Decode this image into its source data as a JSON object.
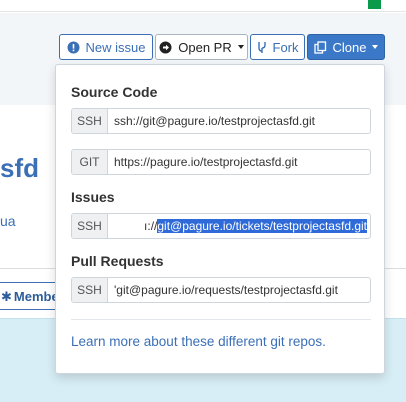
{
  "background": {
    "project_title": "sfd",
    "project_sub": "ua",
    "members_button": "Membe"
  },
  "toolbar": {
    "new_issue": "New issue",
    "open_pr": "Open PR",
    "fork": "Fork",
    "clone": "Clone"
  },
  "clone_menu": {
    "sections": {
      "source_code": "Source Code",
      "issues": "Issues",
      "pull_requests": "Pull Requests"
    },
    "source_ssh": {
      "label": "SSH",
      "value": "ssh://git@pagure.io/testprojectasfd.git"
    },
    "source_git": {
      "label": "GIT",
      "value": "https://pagure.io/testprojectasfd.git"
    },
    "issues_ssh": {
      "label": "SSH",
      "prefix": "ı://",
      "selected": "git@pagure.io/tickets/testprojectasfd.git"
    },
    "pr_ssh": {
      "label": "SSH",
      "value": "'git@pagure.io/requests/testprojectasfd.git"
    },
    "learn_more": "Learn more about these different git repos."
  },
  "colors": {
    "accent": "#3b6fb6",
    "clone_button": "#3b78c8",
    "selection": "#2f6bd8",
    "callout": "#d8eef6"
  }
}
